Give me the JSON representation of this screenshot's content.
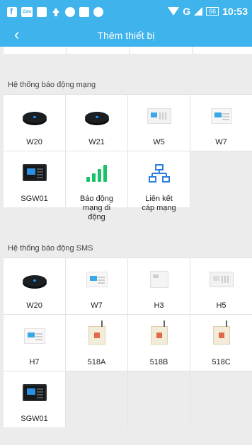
{
  "status_bar": {
    "left_icons": [
      "facebook-icon",
      "zalo-icon",
      "image-icon",
      "upload-icon",
      "chrome-icon",
      "messenger-icon",
      "eye-icon"
    ],
    "zalo_text": "Zalo",
    "network": "G",
    "battery": "66",
    "time": "10:53"
  },
  "appbar": {
    "back_icon": "‹",
    "title": "Thêm thiết bị"
  },
  "sections": [
    {
      "title": "Hệ thống báo động mạng",
      "devices": [
        {
          "label": "W20",
          "icon": "hub-icon"
        },
        {
          "label": "W21",
          "icon": "hub-icon"
        },
        {
          "label": "W5",
          "icon": "panel-white-icon"
        },
        {
          "label": "W7",
          "icon": "panel-small-icon"
        },
        {
          "label": "SGW01",
          "icon": "panel-black-icon"
        },
        {
          "label": "Báo động mạng di động",
          "icon": "signal-bars-icon"
        },
        {
          "label": "Liên kết cáp mạng",
          "icon": "network-tree-icon"
        }
      ]
    },
    {
      "title": "Hệ thống báo động SMS",
      "devices": [
        {
          "label": "W20",
          "icon": "hub-icon"
        },
        {
          "label": "W7",
          "icon": "panel-small-icon"
        },
        {
          "label": "H3",
          "icon": "panel-h3-icon"
        },
        {
          "label": "H5",
          "icon": "panel-white-icon"
        },
        {
          "label": "H7",
          "icon": "panel-small-icon"
        },
        {
          "label": "518A",
          "icon": "gsm-box-icon"
        },
        {
          "label": "518B",
          "icon": "gsm-box-icon"
        },
        {
          "label": "518C",
          "icon": "gsm-box-icon"
        },
        {
          "label": "SGW01",
          "icon": "panel-black-icon"
        }
      ]
    }
  ],
  "colors": {
    "accent": "#3fb3ec",
    "signal_green": "#19c36a",
    "network_blue": "#2a7fe0"
  }
}
